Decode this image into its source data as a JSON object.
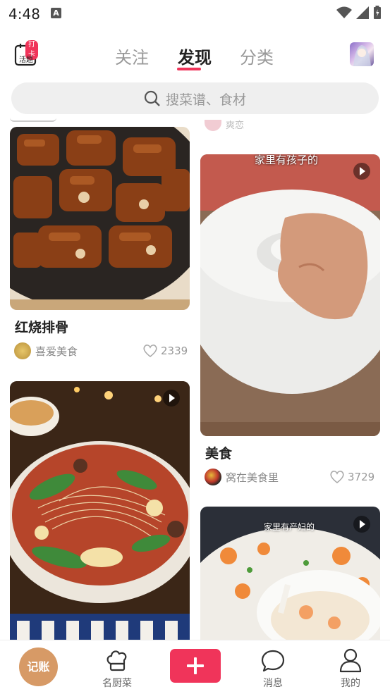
{
  "status_bar": {
    "time": "4:48",
    "a_badge": "A"
  },
  "header": {
    "checkin_badge": "打卡",
    "checkin_label": "活题",
    "tabs": [
      {
        "label": "关注",
        "active": false
      },
      {
        "label": "发现",
        "active": true
      },
      {
        "label": "分类",
        "active": false
      }
    ]
  },
  "search": {
    "placeholder": "搜菜谱、食材"
  },
  "feed": {
    "partial_user": "爽恋",
    "cards": [
      {
        "title": "红烧排骨",
        "user": "喜爱美食",
        "likes": "2339",
        "video": false,
        "overlay": ""
      },
      {
        "title": "美食",
        "user": "窝在美食里",
        "likes": "3729",
        "video": true,
        "overlay": "家里有孩子的"
      },
      {
        "title": "",
        "user": "",
        "likes": "",
        "video": true,
        "overlay": ""
      },
      {
        "title": "",
        "user": "",
        "likes": "",
        "video": true,
        "overlay": "家里有产妇的"
      }
    ]
  },
  "nav": {
    "bookkeeping": "记账",
    "items": [
      {
        "label": "名厨菜",
        "icon": "chef-hat-icon"
      },
      {
        "label": "消息",
        "icon": "chat-bubble-icon"
      },
      {
        "label": "我的",
        "icon": "user-icon"
      }
    ]
  },
  "colors": {
    "accent": "#f0345a",
    "bookkeeping": "#d79a66"
  }
}
